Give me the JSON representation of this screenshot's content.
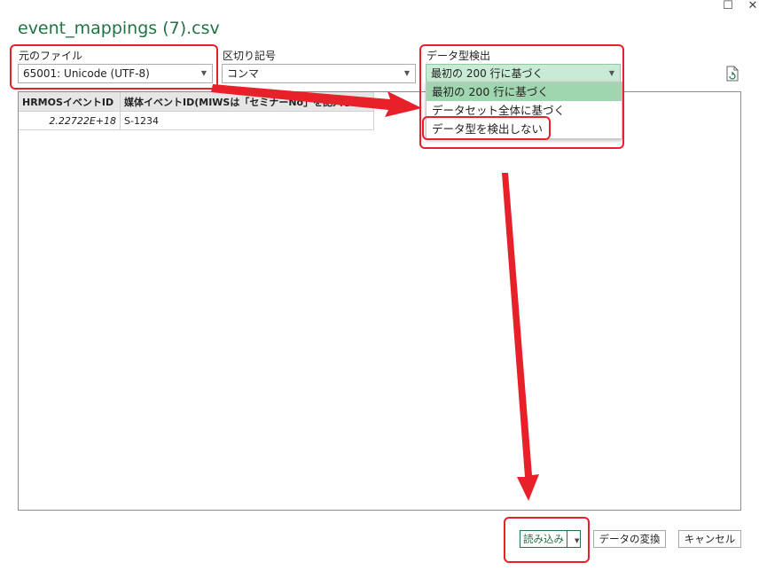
{
  "window": {
    "title": "event_mappings (7).csv",
    "maximize_icon": "maximize-icon",
    "close_icon": "close-icon"
  },
  "file_origin": {
    "label": "元のファイル",
    "value": "65001: Unicode (UTF-8)"
  },
  "delimiter": {
    "label": "区切り記号",
    "value": "コンマ"
  },
  "type_detection": {
    "label": "データ型検出",
    "value": "最初の 200 行に基づく",
    "options": [
      "最初の 200 行に基づく",
      "データセット全体に基づく",
      "データ型を検出しない"
    ]
  },
  "refresh_icon": "refresh-document-icon",
  "preview": {
    "columns": [
      "HRMOSイベントID",
      "媒体イベントID(MIWSは「セミナーNo」を記入して下さい)"
    ],
    "rows": [
      [
        "2.22722E+18",
        "S-1234"
      ]
    ]
  },
  "buttons": {
    "load": "読み込み",
    "transform": "データの変換",
    "cancel": "キャンセル"
  },
  "colors": {
    "accent_green": "#217346",
    "highlight_green": "#9fd6b0",
    "annotation_red": "#e8202a"
  }
}
